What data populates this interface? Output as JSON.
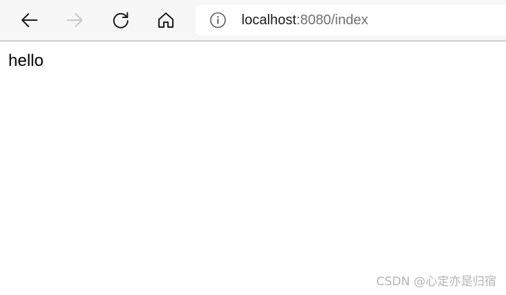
{
  "browser": {
    "url_host": "localhost",
    "url_rest": ":8080/index",
    "icons": {
      "back": "back-arrow-icon",
      "forward": "forward-arrow-icon",
      "reload": "reload-icon",
      "home": "home-icon",
      "info": "info-icon"
    },
    "colors": {
      "toolbar_bg": "#f7f7f7",
      "forward_disabled": "#c8c8c8",
      "url_secondary": "#707070"
    }
  },
  "page": {
    "text": "hello"
  },
  "watermark": {
    "text": "CSDN @心定亦是归宿"
  }
}
